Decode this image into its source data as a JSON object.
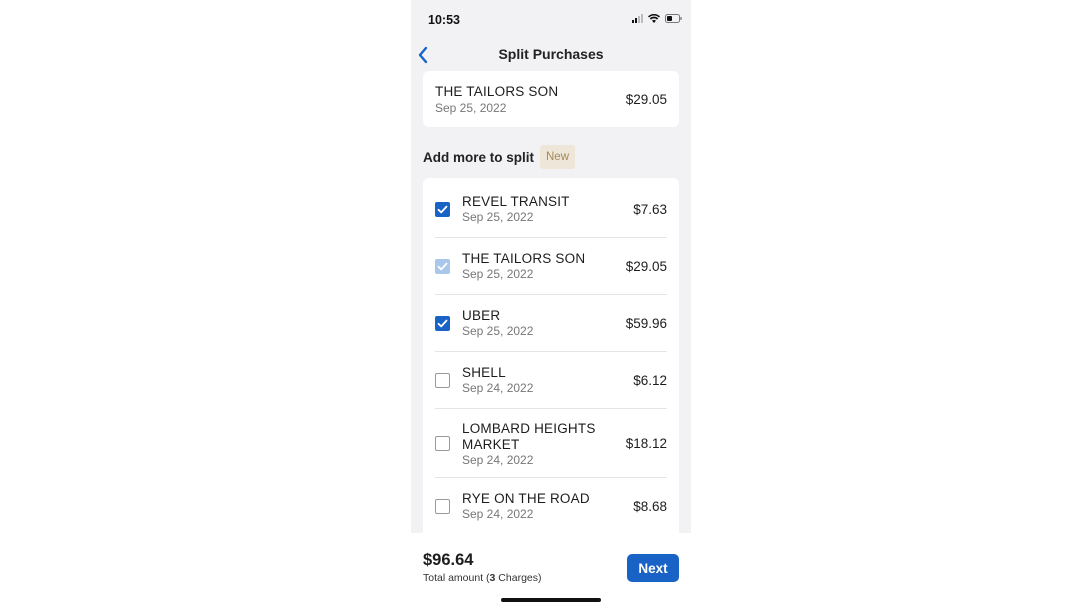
{
  "status_bar": {
    "time": "10:53"
  },
  "nav": {
    "title": "Split Purchases",
    "back_icon": "chevron-left-icon"
  },
  "selected_purchase": {
    "merchant": "THE TAILORS SON",
    "date": "Sep 25, 2022",
    "amount": "$29.05"
  },
  "section": {
    "title": "Add more to split",
    "badge": "New"
  },
  "transactions": [
    {
      "merchant": "REVEL TRANSIT",
      "date": "Sep 25, 2022",
      "amount": "$7.63",
      "state": "checked"
    },
    {
      "merchant": "THE TAILORS SON",
      "date": "Sep 25, 2022",
      "amount": "$29.05",
      "state": "checked-disabled"
    },
    {
      "merchant": "UBER",
      "date": "Sep 25, 2022",
      "amount": "$59.96",
      "state": "checked"
    },
    {
      "merchant": "SHELL",
      "date": "Sep 24, 2022",
      "amount": "$6.12",
      "state": "unchecked"
    },
    {
      "merchant_line1": "LOMBARD HEIGHTS",
      "merchant_line2": "MARKET",
      "date": "Sep 24, 2022",
      "amount": "$18.12",
      "state": "unchecked"
    },
    {
      "merchant": "RYE ON THE ROAD",
      "date": "Sep 24, 2022",
      "amount": "$8.68",
      "state": "unchecked"
    }
  ],
  "footer": {
    "total": "$96.64",
    "label_prefix": "Total amount (",
    "count": "3",
    "label_suffix": " Charges)",
    "next_label": "Next"
  },
  "colors": {
    "accent": "#1a63c6",
    "accent_disabled": "#a9c7ea",
    "badge_bg": "#ede6d9",
    "badge_text": "#a58a55"
  }
}
